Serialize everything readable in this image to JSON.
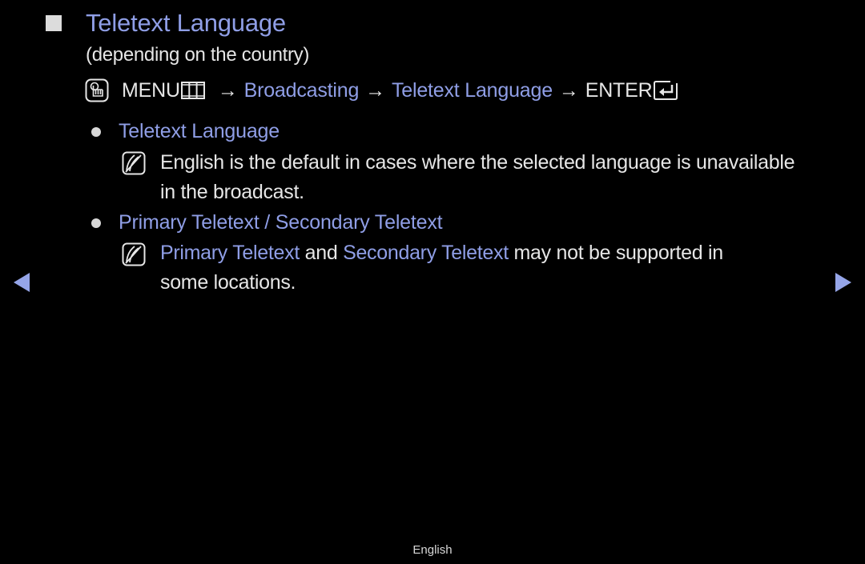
{
  "page": {
    "title": "Teletext Language",
    "subtitle": "(depending on the country)",
    "footer_language": "English"
  },
  "menu_path": {
    "icon": "otools-hand-icon",
    "steps": [
      {
        "label": "MENU",
        "highlight": false,
        "icon": "menu-grid-icon"
      },
      {
        "label": "Broadcasting",
        "highlight": true
      },
      {
        "label": "Teletext Language",
        "highlight": true
      },
      {
        "label": "ENTER",
        "highlight": false,
        "icon": "enter-icon"
      }
    ],
    "separator": "→"
  },
  "sections": [
    {
      "heading": "Teletext Language",
      "notes": [
        {
          "icon": "note-icon",
          "lines": [
            "English is the default in cases where the selected language is unavailable",
            "in the broadcast."
          ]
        }
      ]
    },
    {
      "heading": "Primary Teletext / Secondary Teletext",
      "notes": [
        {
          "icon": "note-icon",
          "segments": [
            {
              "text": "Primary Teletext",
              "highlight": true
            },
            {
              "text": " and ",
              "highlight": false
            },
            {
              "text": "Secondary Teletext",
              "highlight": true
            },
            {
              "text": " may not be supported in",
              "highlight": false
            }
          ],
          "second_line": "some locations."
        }
      ]
    }
  ],
  "navigation": {
    "prev_icon": "triangle-left-icon",
    "next_icon": "triangle-right-icon"
  },
  "colors": {
    "background": "#000000",
    "highlight": "#8f9ee6",
    "text": "#e6e6e6",
    "nav_arrow": "#95a5e8"
  }
}
